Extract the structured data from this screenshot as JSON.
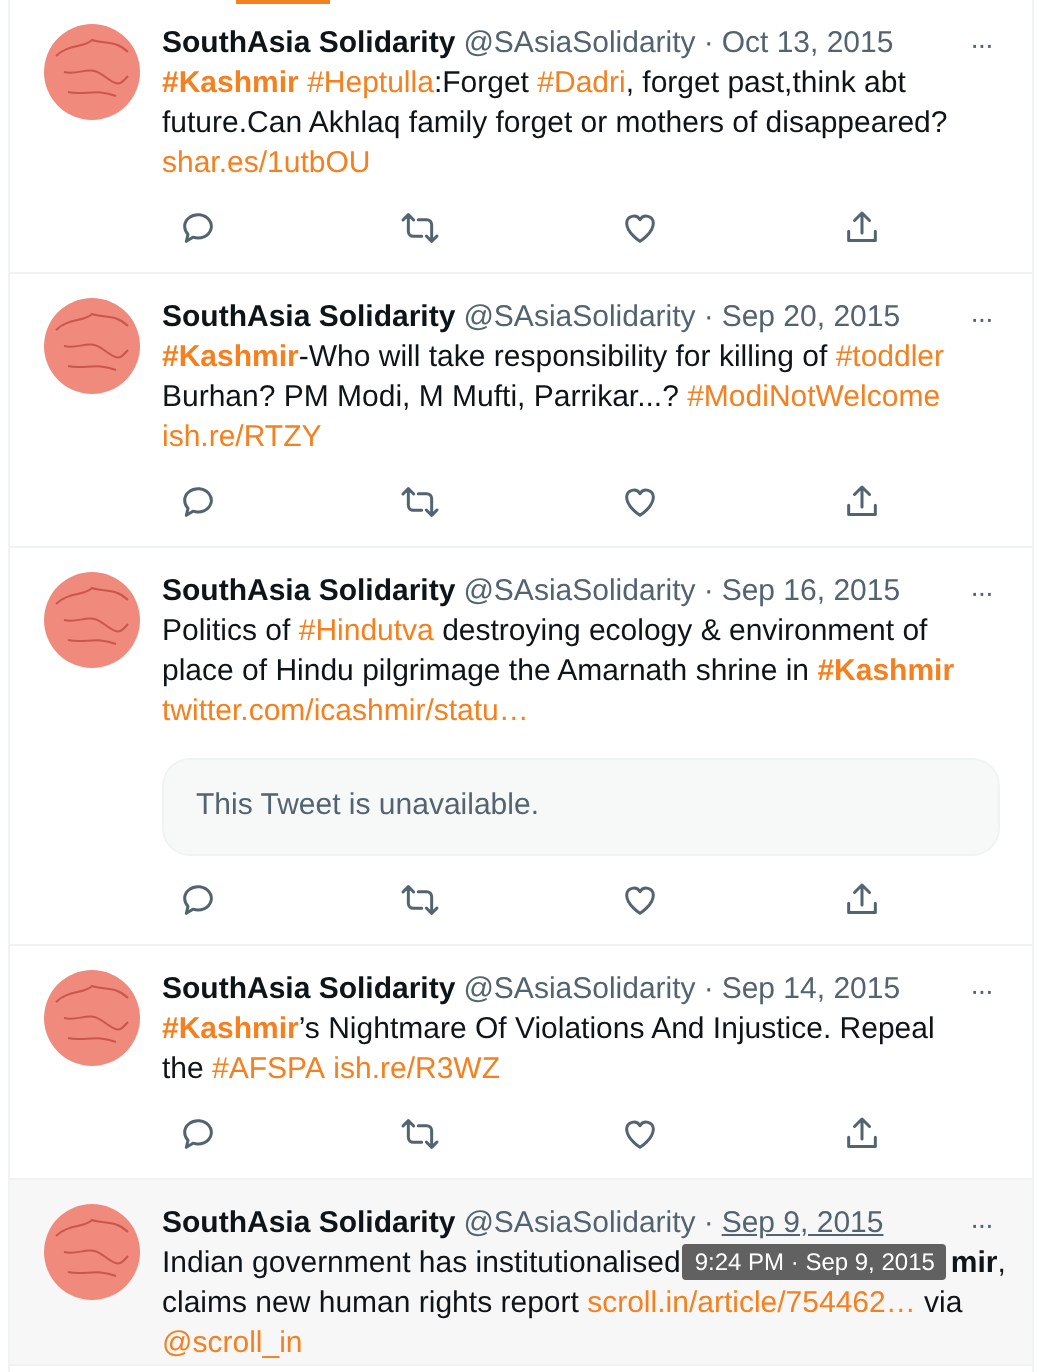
{
  "tweets": [
    {
      "name": "SouthAsia Solidarity",
      "handle": "@SAsiaSolidarity",
      "separator": "·",
      "date": "Oct 13, 2015",
      "more": "···",
      "hovered": false,
      "lines": [
        [
          {
            "kind": "link",
            "text": "#Kashmir",
            "bold": true
          },
          {
            "kind": "link",
            "text": "#Heptulla",
            "bold": false,
            "spaced": true
          },
          {
            "kind": "plain",
            "text": ":Forget "
          },
          {
            "kind": "link",
            "text": "#Dadri",
            "bold": false
          },
          {
            "kind": "plain",
            "text": ", forget past,think abt"
          }
        ],
        [
          {
            "kind": "plain",
            "text": "future.Can Akhlaq family forget or mothers of disappeared?"
          }
        ],
        [
          {
            "kind": "link",
            "text": "shar.es/1utbOU",
            "bold": false
          }
        ]
      ]
    },
    {
      "name": "SouthAsia Solidarity",
      "handle": "@SAsiaSolidarity",
      "separator": "·",
      "date": "Sep 20, 2015",
      "more": "···",
      "hovered": false,
      "lines": [
        [
          {
            "kind": "link",
            "text": "#Kashmir",
            "bold": true
          },
          {
            "kind": "plain",
            "text": "-Who will take responsibility for killing of "
          },
          {
            "kind": "link",
            "text": "#toddler",
            "bold": false
          }
        ],
        [
          {
            "kind": "plain",
            "text": "Burhan? PM Modi, M Mufti, Parrikar...? "
          },
          {
            "kind": "link",
            "text": "#ModiNotWelcome",
            "bold": false
          }
        ],
        [
          {
            "kind": "link",
            "text": "ish.re/RTZY",
            "bold": false
          }
        ]
      ]
    },
    {
      "name": "SouthAsia Solidarity",
      "handle": "@SAsiaSolidarity",
      "separator": "·",
      "date": "Sep 16, 2015",
      "more": "···",
      "hovered": false,
      "lines": [
        [
          {
            "kind": "plain",
            "text": "Politics of "
          },
          {
            "kind": "link",
            "text": "#Hindutva",
            "bold": false
          },
          {
            "kind": "plain",
            "text": " destroying ecology & environment of"
          }
        ],
        [
          {
            "kind": "plain",
            "text": "place of Hindu pilgrimage the Amarnath shrine in "
          },
          {
            "kind": "link",
            "text": "#Kashmir",
            "bold": true
          }
        ],
        [
          {
            "kind": "link",
            "text": "twitter.com/icashmir/statu…",
            "bold": false
          }
        ]
      ],
      "quote": "This Tweet is unavailable."
    },
    {
      "name": "SouthAsia Solidarity",
      "handle": "@SAsiaSolidarity",
      "separator": "·",
      "date": "Sep 14, 2015",
      "more": "···",
      "hovered": false,
      "lines": [
        [
          {
            "kind": "link",
            "text": "#Kashmir",
            "bold": true
          },
          {
            "kind": "plain",
            "text": "’s Nightmare Of Violations And Injustice. Repeal"
          }
        ],
        [
          {
            "kind": "plain",
            "text": "the "
          },
          {
            "kind": "link",
            "text": "#AFSPA",
            "bold": false
          },
          {
            "kind": "link",
            "text": "ish.re/R3WZ",
            "bold": false,
            "spaced": true
          }
        ]
      ]
    },
    {
      "name": "SouthAsia Solidarity",
      "handle": "@SAsiaSolidarity",
      "separator": "·",
      "date": "Sep 9, 2015",
      "more": "···",
      "hovered": true,
      "lines": [
        [
          {
            "kind": "plain",
            "text": "Indian government has institutionalised"
          },
          {
            "kind": "tooltip",
            "text": "9:24 PM · Sep 9, 2015"
          },
          {
            "kind": "bold",
            "text": "mir"
          },
          {
            "kind": "plain",
            "text": ","
          }
        ],
        [
          {
            "kind": "plain",
            "text": "claims new human rights report "
          },
          {
            "kind": "link",
            "text": "scroll.in/article/754462…",
            "bold": false
          },
          {
            "kind": "plain",
            "text": " via"
          }
        ],
        [
          {
            "kind": "link",
            "text": "@scroll_in",
            "bold": false
          }
        ]
      ]
    }
  ]
}
